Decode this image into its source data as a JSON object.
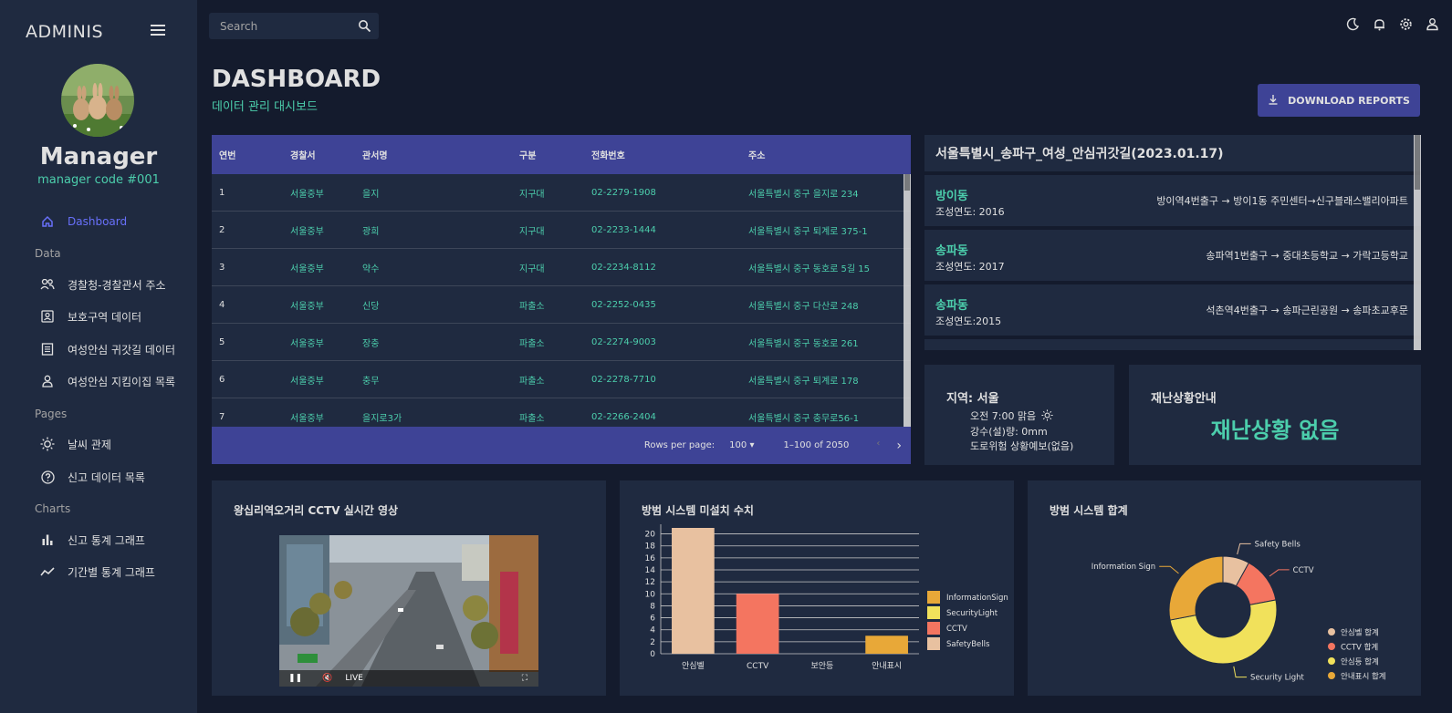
{
  "app": {
    "brand": "ADMINIS"
  },
  "profile": {
    "name": "Manager",
    "code": "manager code #001"
  },
  "sidebar": {
    "dashboard": "Dashboard",
    "sections": {
      "data": "Data",
      "pages": "Pages",
      "charts": "Charts"
    },
    "data_items": [
      "경찰청-경찰관서 주소",
      "보호구역 데이터",
      "여성안심 귀갓길 데이터",
      "여성안심 지킴이집 목록"
    ],
    "pages_items": [
      "날씨 관제",
      "신고 데이터 목록"
    ],
    "charts_items": [
      "신고 통계 그래프",
      "기간별 통계 그래프"
    ]
  },
  "search": {
    "placeholder": "Search"
  },
  "header": {
    "title": "DASHBOARD",
    "subtitle": "데이터 관리 대시보드",
    "download": "DOWNLOAD REPORTS"
  },
  "table": {
    "columns": [
      "연번",
      "경찰서",
      "관서명",
      "구분",
      "전화번호",
      "주소"
    ],
    "rows": [
      [
        "1",
        "서울중부",
        "을지",
        "지구대",
        "02-2279-1908",
        "서울특별시 중구 을지로 234"
      ],
      [
        "2",
        "서울중부",
        "광희",
        "지구대",
        "02-2233-1444",
        "서울특별시 중구 퇴계로 375-1"
      ],
      [
        "3",
        "서울중부",
        "약수",
        "지구대",
        "02-2234-8112",
        "서울특별시 중구 동호로 5길 15"
      ],
      [
        "4",
        "서울중부",
        "신당",
        "파출소",
        "02-2252-0435",
        "서울특별시 중구 다산로 248"
      ],
      [
        "5",
        "서울중부",
        "장충",
        "파출소",
        "02-2274-9003",
        "서울특별시 중구 동호로 261"
      ],
      [
        "6",
        "서울중부",
        "충무",
        "파출소",
        "02-2278-7710",
        "서울특별시 중구 퇴계로 178"
      ],
      [
        "7",
        "서울중부",
        "을지로3가",
        "파출소",
        "02-2266-2404",
        "서울특별시 중구 충무로56-1"
      ]
    ],
    "rows_per_page_label": "Rows per page:",
    "rows_per_page": "100",
    "range": "1–100 of 2050"
  },
  "routes": {
    "title": "서울특별시_송파구_여성_안심귀갓길(2023.01.17)",
    "items": [
      {
        "name": "방이동",
        "year": "조성연도: 2016",
        "path": "방이역4번출구 → 방이1동 주민센터→신구블래스밸리아파트"
      },
      {
        "name": "송파동",
        "year": "조성연도: 2017",
        "path": "송파역1번출구 → 중대초등학교 → 가락고등학교"
      },
      {
        "name": "송파동",
        "year": "조성연도:2015",
        "path": "석촌역4번출구 → 송파근린공원 → 송파초교후문"
      }
    ]
  },
  "weather": {
    "region": "지역: 서울",
    "line1": "오전 7:00 맑음",
    "line2": "강수(설)량: 0mm",
    "line3": "도로위험 상황예보(없음)"
  },
  "disaster": {
    "title": "재난상황안내",
    "status": "재난상황 없음"
  },
  "cctv": {
    "title": "왕십리역오거리 CCTV 실시간 영상",
    "live": "LIVE"
  },
  "bar_title": "방범 시스템 미설치 수치",
  "pie_title": "방범 시스템 합계",
  "chart_data": [
    {
      "type": "bar",
      "title": "방범 시스템 미설치 수치",
      "categories": [
        "안심벨",
        "CCTV",
        "보안등",
        "안내표시"
      ],
      "values": [
        21,
        10,
        0,
        3
      ],
      "bar_colors": [
        "#e8c1a0",
        "#f47560",
        "#f1e15b",
        "#e8a838"
      ],
      "ylim": [
        0,
        21
      ],
      "yticks": [
        0,
        2,
        4,
        6,
        8,
        10,
        12,
        14,
        16,
        18,
        20
      ],
      "legend": [
        "InformationSign",
        "SecurityLight",
        "CCTV",
        "SafetyBells"
      ],
      "legend_colors": [
        "#e8a838",
        "#f1e15b",
        "#f47560",
        "#e8c1a0"
      ],
      "legend_position": "right",
      "grid": true
    },
    {
      "type": "pie",
      "title": "방범 시스템 합계",
      "slices": [
        {
          "label": "Safety Bells",
          "value": 8,
          "color": "#e8c1a0"
        },
        {
          "label": "CCTV",
          "value": 14,
          "color": "#f47560"
        },
        {
          "label": "Security Light",
          "value": 50,
          "color": "#f1e15b"
        },
        {
          "label": "Information Sign",
          "value": 28,
          "color": "#e8a838"
        }
      ],
      "legend": [
        {
          "label": "안심벨 합계",
          "color": "#e8c1a0"
        },
        {
          "label": "CCTV 합계",
          "color": "#f47560"
        },
        {
          "label": "안심등 합계",
          "color": "#f1e15b"
        },
        {
          "label": "안내표시 합계",
          "color": "#e8a838"
        }
      ],
      "legend_position": "bottom-right",
      "donut": true
    }
  ],
  "colors": {
    "accent": "#4cceac",
    "primary": "#3e4396",
    "active": "#6870fa",
    "panel": "#1f2a40",
    "bg": "#141b2d"
  }
}
